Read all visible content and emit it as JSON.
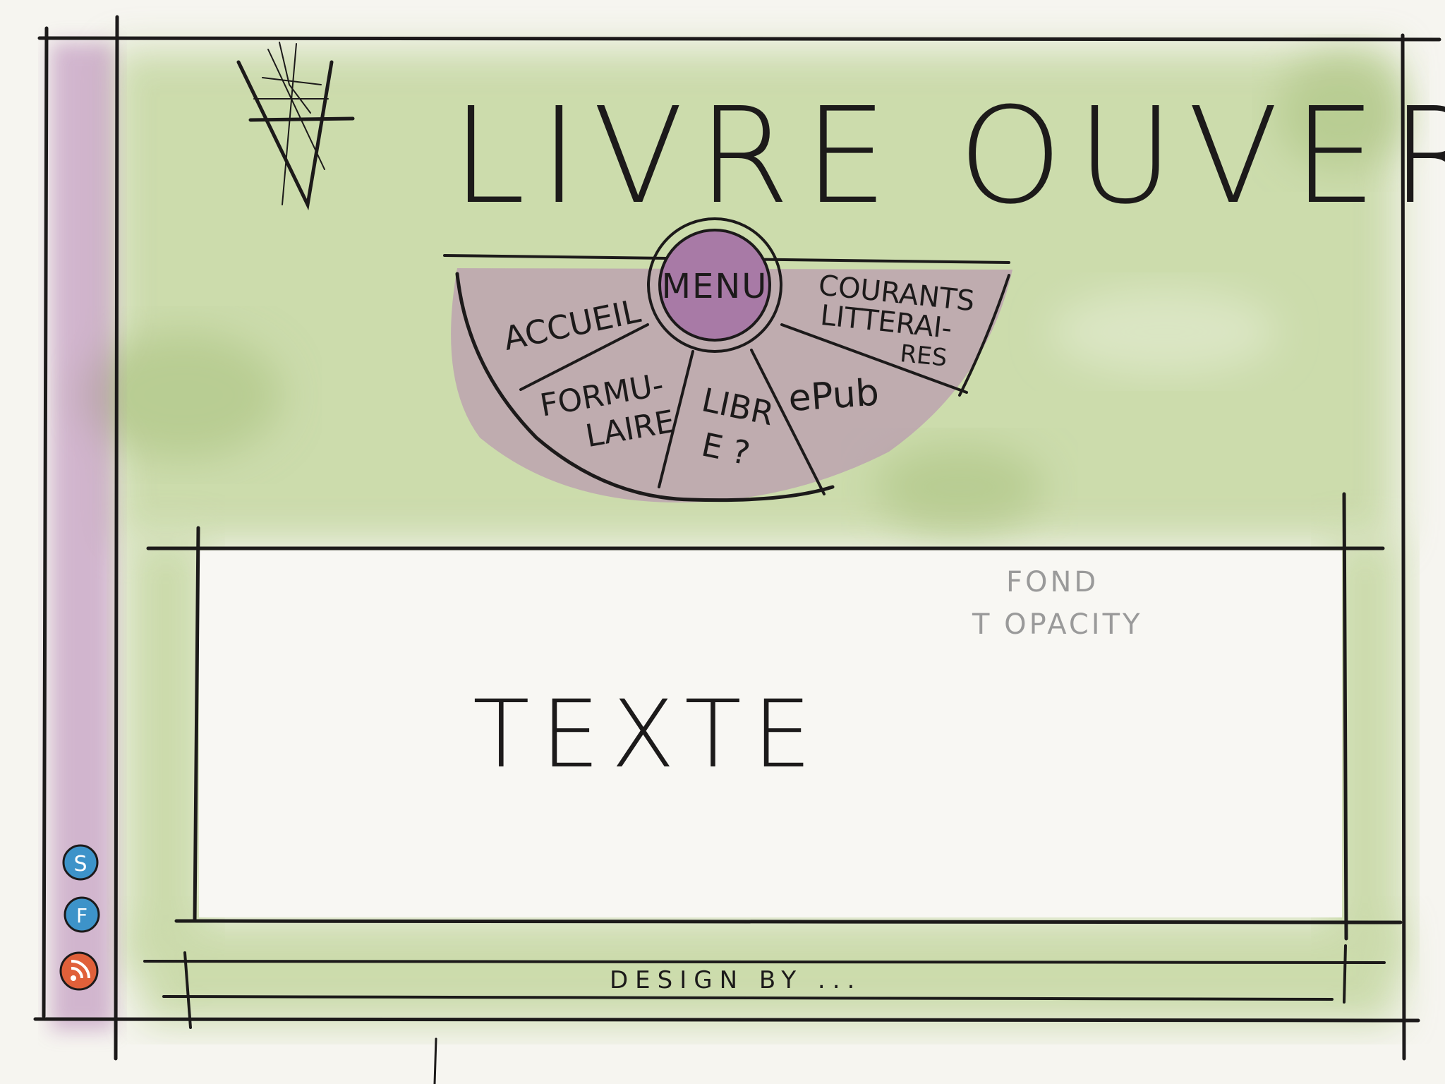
{
  "header": {
    "title": "LIVRE OUVERT"
  },
  "menu": {
    "center_label": "MENU",
    "items": [
      {
        "lines": [
          "ACCUEIL"
        ]
      },
      {
        "lines": [
          "COURANTS",
          "LITTERAI-",
          "RES"
        ]
      },
      {
        "lines": [
          "FORMU-",
          "LAIRE"
        ]
      },
      {
        "lines": [
          "LIBR",
          "E ?"
        ]
      },
      {
        "lines": [
          "ePub"
        ]
      }
    ]
  },
  "content": {
    "body_text": "TEXTE",
    "note_lines": [
      "FOND",
      "T OPACITY"
    ]
  },
  "footer": {
    "text": "DESIGN BY ..."
  },
  "social": {
    "icons": [
      {
        "name": "skype-icon",
        "glyph": "S",
        "color": "#3d93c9"
      },
      {
        "name": "facebook-icon",
        "glyph": "F",
        "color": "#3d93c9"
      },
      {
        "name": "rss-icon",
        "glyph": "rss",
        "color": "#e0603a"
      }
    ]
  },
  "colors": {
    "wash_green": "#9cbd5c",
    "wash_purple": "#b57fb0",
    "ink": "#1c1a1a"
  }
}
